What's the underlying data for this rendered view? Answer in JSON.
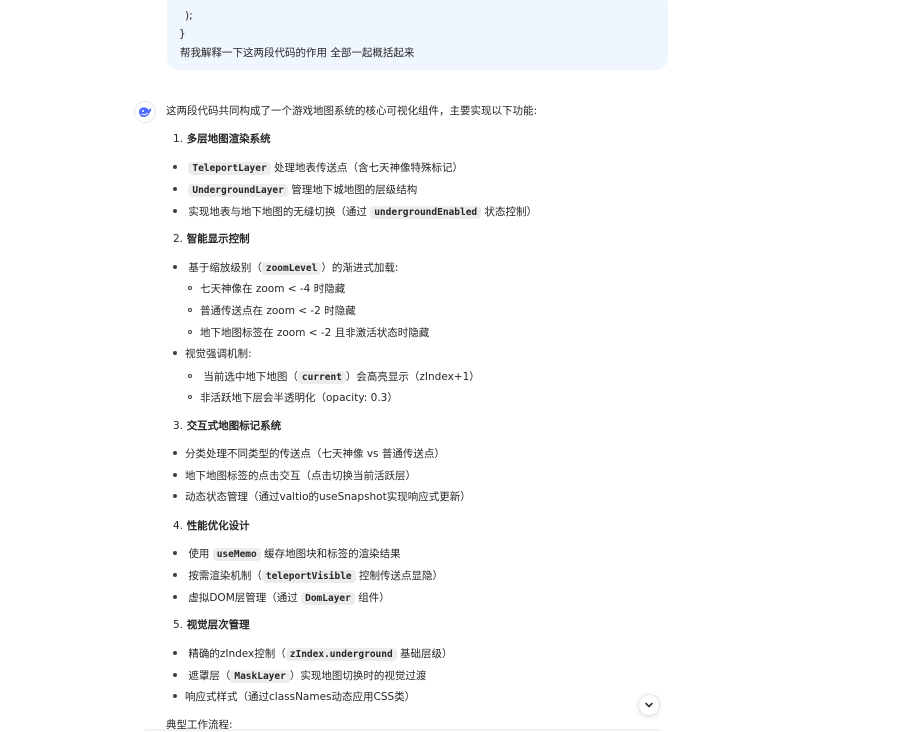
{
  "user_message": {
    "code_line_1": ");",
    "code_line_2": "}",
    "question": "帮我解释一下这两段代码的作用 全部一起概括起来"
  },
  "assistant": {
    "avatar_icon": "deepseek-whale-icon",
    "brand_color": "#4d6bfe",
    "intro": "这两段代码共同构成了一个游戏地图系统的核心可视化组件，主要实现以下功能:",
    "sections": [
      {
        "num": "1.",
        "title": "多层地图渲染系统",
        "items": [
          {
            "code": "TeleportLayer",
            "text": " 处理地表传送点（含七天神像特殊标记）"
          },
          {
            "code": "UndergroundLayer",
            "text": " 管理地下城地图的层级结构"
          },
          {
            "pre": "实现地表与地下地图的无缝切换（通过 ",
            "code": "undergroundEnabled",
            "post": " 状态控制）"
          }
        ]
      },
      {
        "num": "2.",
        "title": "智能显示控制",
        "items": [
          {
            "pre": "基于缩放级别（",
            "code": "zoomLevel",
            "post": "）的渐进式加载:"
          },
          {
            "sub": "七天神像在 zoom < -4 时隐藏"
          },
          {
            "sub": "普通传送点在 zoom < -2 时隐藏"
          },
          {
            "sub": "地下地图标签在 zoom < -2 且非激活状态时隐藏"
          },
          {
            "text": "视觉强调机制:"
          },
          {
            "sub_pre": "当前选中地下地图（",
            "code": "current",
            "sub_post": "）会高亮显示（zIndex+1）"
          },
          {
            "sub": "非活跃地下层会半透明化（opacity: 0.3）"
          }
        ]
      },
      {
        "num": "3.",
        "title": "交互式地图标记系统",
        "items": [
          {
            "text": "分类处理不同类型的传送点（七天神像 vs 普通传送点）"
          },
          {
            "text": "地下地图标签的点击交互（点击切换当前活跃层）"
          },
          {
            "text": "动态状态管理（通过valtio的useSnapshot实现响应式更新）"
          }
        ]
      },
      {
        "num": "4.",
        "title": "性能优化设计",
        "items": [
          {
            "pre": "使用 ",
            "code": "useMemo",
            "post": " 缓存地图块和标签的渲染结果"
          },
          {
            "pre": "按需渲染机制（",
            "code": "teleportVisible",
            "post": " 控制传送点显隐）"
          },
          {
            "pre": "虚拟DOM层管理（通过 ",
            "code": "DomLayer",
            "post": " 组件）"
          }
        ]
      },
      {
        "num": "5.",
        "title": "视觉层次管理",
        "items": [
          {
            "pre": "精确的zIndex控制（",
            "code": "zIndex.underground",
            "post": " 基础层级）"
          },
          {
            "pre": "遮罩层（",
            "code": "MaskLayer",
            "post": "）实现地图切换时的视觉过渡"
          },
          {
            "text": "响应式样式（通过classNames动态应用CSS类）"
          }
        ]
      }
    ],
    "workflow_label": "典型工作流程:"
  },
  "scroll_button": {
    "icon": "chevron-down-icon"
  }
}
